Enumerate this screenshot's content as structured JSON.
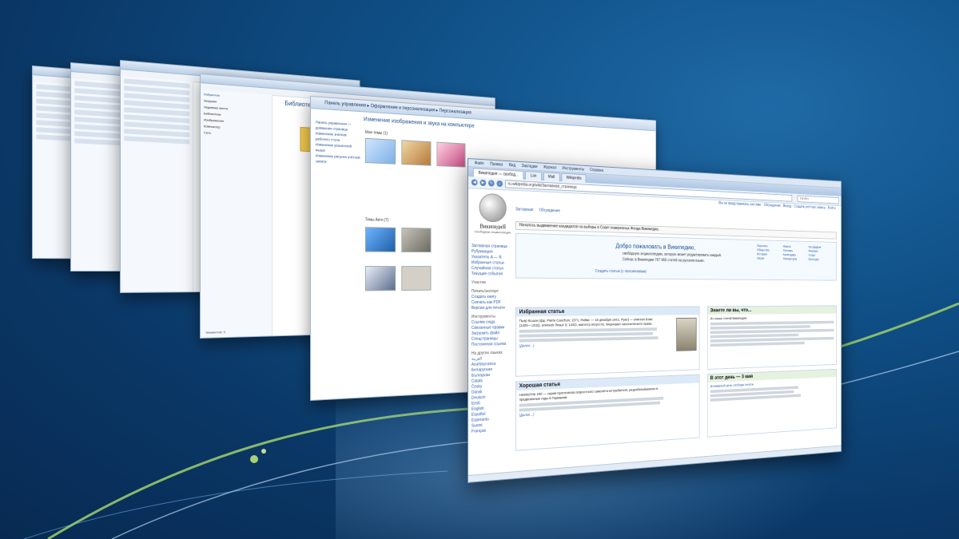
{
  "browser": {
    "menu": [
      "Файл",
      "Правка",
      "Вид",
      "Закладки",
      "Журнал",
      "Инструменты",
      "Справка"
    ],
    "tabs": [
      {
        "label": "Википедия — свобод...",
        "active": true
      },
      {
        "label": "Lan",
        "active": false
      },
      {
        "label": "Mail",
        "active": false
      },
      {
        "label": "Wikipedia",
        "active": false
      }
    ],
    "address": "ru.wikipedia.org/wiki/Заглавная_страница",
    "search_placeholder": "Yandex"
  },
  "wiki": {
    "logo_title": "ВикипедиЯ",
    "logo_subtitle": "Свободная энциклопедия",
    "top_links": "Вы не представились системе · Обсуждение · Вклад · Создать учётную запись · Войти",
    "tabs": [
      "Заглавная",
      "Обсуждение",
      "Читать",
      "Просмотр кода",
      "История"
    ],
    "notice": "Началось выдвижение кандидатов на выборы в Совет поверенных Фонда Викимедиа.",
    "welcome": {
      "title": "Добро пожаловать в Википедию,",
      "line1": "свободную энциклопедию, которую может редактировать каждый.",
      "line2": "Сейчас в Википедии 707 969 статей на русском языке.",
      "create": "Создать статью (с пояснениями)"
    },
    "portals": [
      "Порталы",
      "Общество",
      "История",
      "Наука",
      "Жизнь",
      "Техника",
      "Календарь",
      "Литература",
      "География",
      "Религия",
      "Спорт",
      "Культура"
    ],
    "leftnav": {
      "main": [
        "Заглавная страница",
        "Рубрикация",
        "Указатель А — Я",
        "Избранные статьи",
        "Случайная статья",
        "Текущие события"
      ],
      "participation_head": "Участие",
      "print_head": "Печать/экспорт",
      "print": [
        "Создать книгу",
        "Скачать как PDF",
        "Версия для печати"
      ],
      "tools_head": "Инструменты",
      "tools": [
        "Ссылки сюда",
        "Связанные правки",
        "Загрузить файл",
        "Спецстраницы",
        "Постоянная ссылка"
      ],
      "lang_head": "На других языках",
      "langs": [
        "العربية",
        "Azərbaycanca",
        "Беларуская",
        "Български",
        "Català",
        "Česky",
        "Dansk",
        "Deutsch",
        "Eesti",
        "English",
        "Español",
        "Esperanto",
        "Suomi",
        "Français"
      ]
    },
    "featured": {
      "title": "Избранная статья",
      "lead": "Пьер Кошон (фр. Pierre Cauchon; 1371, Реймс — 18 декабря 1442, Руан) — епископ Бове (1420—1432), епископ Лизьё (с 1432), магистр искусств, лиценциат канонического права.",
      "more": "(Далее...)"
    },
    "good": {
      "title": "Хорошая статья",
      "lead": "Heinkel He 100 — серия прототипов скоростного самолёта-истребителя, разрабатываемого в предвоенные годы в Германии.",
      "more": "(Далее...)"
    },
    "didyouknow": {
      "title": "Знаете ли вы, что...",
      "lead": "Из новых статей Википедии:"
    },
    "thisday": {
      "title": "В этот день — 3 мая",
      "lead": "Всемирный день свободы печати"
    }
  },
  "personalize": {
    "breadcrumb": "Панель управления ▸ Оформление и персонализация ▸ Персонализация",
    "heading": "Изменение изображения и звука на компьютере",
    "themes_my": "Мои темы (1)",
    "themes_aero": "Темы Aero (7)",
    "theme_names": [
      "Несохранённая тема",
      "Harvest Time",
      "Holiday Lights",
      "Windows 7",
      "Архитектура",
      "Персонажи",
      "Классическая"
    ],
    "side_links": [
      "Панель управления — домашняя страница",
      "Изменение значков рабочего стола",
      "Изменение указателей мыши",
      "Изменение рисунка учётной записи"
    ]
  },
  "explorer": {
    "title": "Библиотека «Изображения»",
    "sidebar": [
      "Избранное",
      "Загрузки",
      "Недавние места",
      "Рабочий стол",
      "Библиотеки",
      "Видео",
      "Документы",
      "Изображения",
      "Музыка",
      "Компьютер",
      "Локальный диск (C:)",
      "Сеть"
    ],
    "status": "Элементов: 3"
  }
}
